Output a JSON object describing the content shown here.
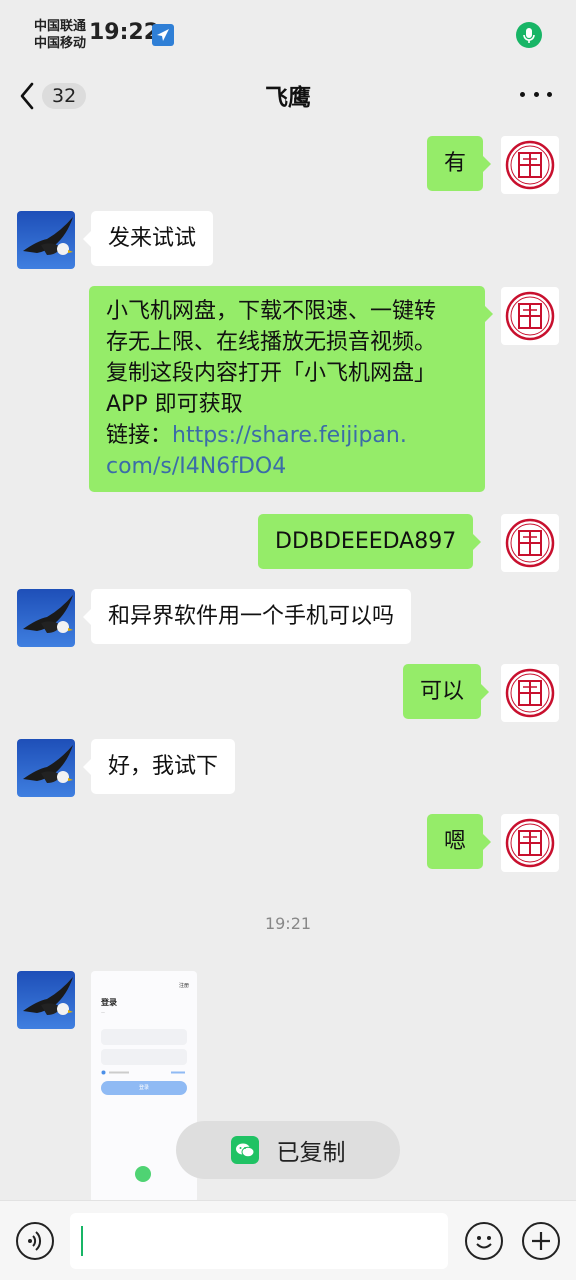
{
  "status_bar": {
    "carrier_1": "中国联通",
    "carrier_2": "中国移动",
    "time": "19:22",
    "location_icon": "location-arrow-icon",
    "mic_icon": "microphone-icon"
  },
  "nav": {
    "back_icon": "chevron-left-icon",
    "unread_count": "32",
    "title": "飞鹰",
    "more_icon": "more-dots-icon"
  },
  "messages": [
    {
      "sender": "me",
      "avatar": "fu-seal-avatar",
      "text": "有"
    },
    {
      "sender": "other",
      "avatar": "eagle-avatar",
      "text": "发来试试"
    },
    {
      "sender": "me",
      "avatar": "fu-seal-avatar",
      "lines": [
        "小飞机网盘，下载不限速、一键转",
        "存无上限、在线播放无损音视频。",
        "复制这段内容打开「小飞机网盘」",
        "APP 即可获取"
      ],
      "link_prefix": "链接：",
      "link_line_1": "https://share.feijipan.",
      "link_line_2": "com/s/I4N6fDO4"
    },
    {
      "sender": "me",
      "avatar": "fu-seal-avatar",
      "text": "DDBDEEEDA897"
    },
    {
      "sender": "other",
      "avatar": "eagle-avatar",
      "text": "和异界软件用一个手机可以吗"
    },
    {
      "sender": "me",
      "avatar": "fu-seal-avatar",
      "text": "可以"
    },
    {
      "sender": "other",
      "avatar": "eagle-avatar",
      "text": "好，我试下"
    },
    {
      "sender": "me",
      "avatar": "fu-seal-avatar",
      "text": "嗯"
    }
  ],
  "timestamp": "19:21",
  "image_message": {
    "sender": "other",
    "title": "登录",
    "register": "注册",
    "login_button": "登录"
  },
  "toast": {
    "text": "已复制",
    "icon": "wechat-icon"
  },
  "input_bar": {
    "voice_icon": "voice-icon",
    "emoji_icon": "emoji-icon",
    "plus_icon": "plus-icon"
  },
  "colors": {
    "background": "#ededed",
    "outgoing_bubble": "#95ec69",
    "incoming_bubble": "#ffffff",
    "link": "#3b6ca8",
    "accent_green": "#18b566"
  }
}
